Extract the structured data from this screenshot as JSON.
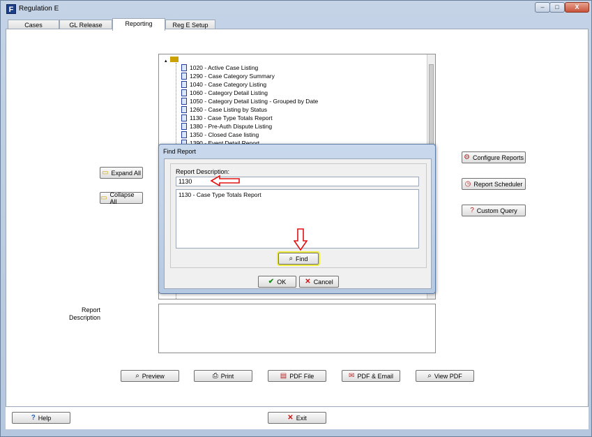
{
  "window": {
    "title": "Regulation E",
    "app_icon": "F",
    "minimize_glyph": "–",
    "maximize_glyph": "□",
    "close_glyph": "X"
  },
  "tabs": [
    {
      "label": "Cases"
    },
    {
      "label": "GL Release"
    },
    {
      "label": "Reporting"
    },
    {
      "label": "Reg E Setup"
    }
  ],
  "left_buttons": {
    "expand": "Expand All",
    "collapse": "Collapse All"
  },
  "right_buttons": {
    "configure": "Configure Reports",
    "scheduler": "Report Scheduler",
    "custom": "Custom Query"
  },
  "tree": {
    "items": [
      "1020 - Active Case Listing",
      "1290 - Case Category Summary",
      "1040 - Case Category Listing",
      "1060 - Category Detail Listing",
      "1050 - Category Detail Listing - Grouped by Date",
      "1260 - Case Listing by Status",
      "1130 - Case Type Totals Report",
      "1380 - Pre-Auth Dispute Listing",
      "1350 - Closed Case listing",
      "1390 - Event Detail Report"
    ]
  },
  "description": {
    "label_line1": "Report",
    "label_line2": "Description"
  },
  "action_buttons": {
    "preview": "Preview",
    "print": "Print",
    "pdf_file": "PDF File",
    "pdf_email": "PDF & Email",
    "view_pdf": "View PDF"
  },
  "bottom": {
    "help": "Help",
    "exit": "Exit"
  },
  "dialog": {
    "title": "Find Report",
    "group_label": "Report Description:",
    "search_value": "1130",
    "result": "1130 - Case Type Totals Report",
    "find": "Find",
    "ok": "OK",
    "cancel": "Cancel"
  },
  "colors": {
    "accent_red": "#e01010",
    "find_highlight": "#eded3a"
  }
}
